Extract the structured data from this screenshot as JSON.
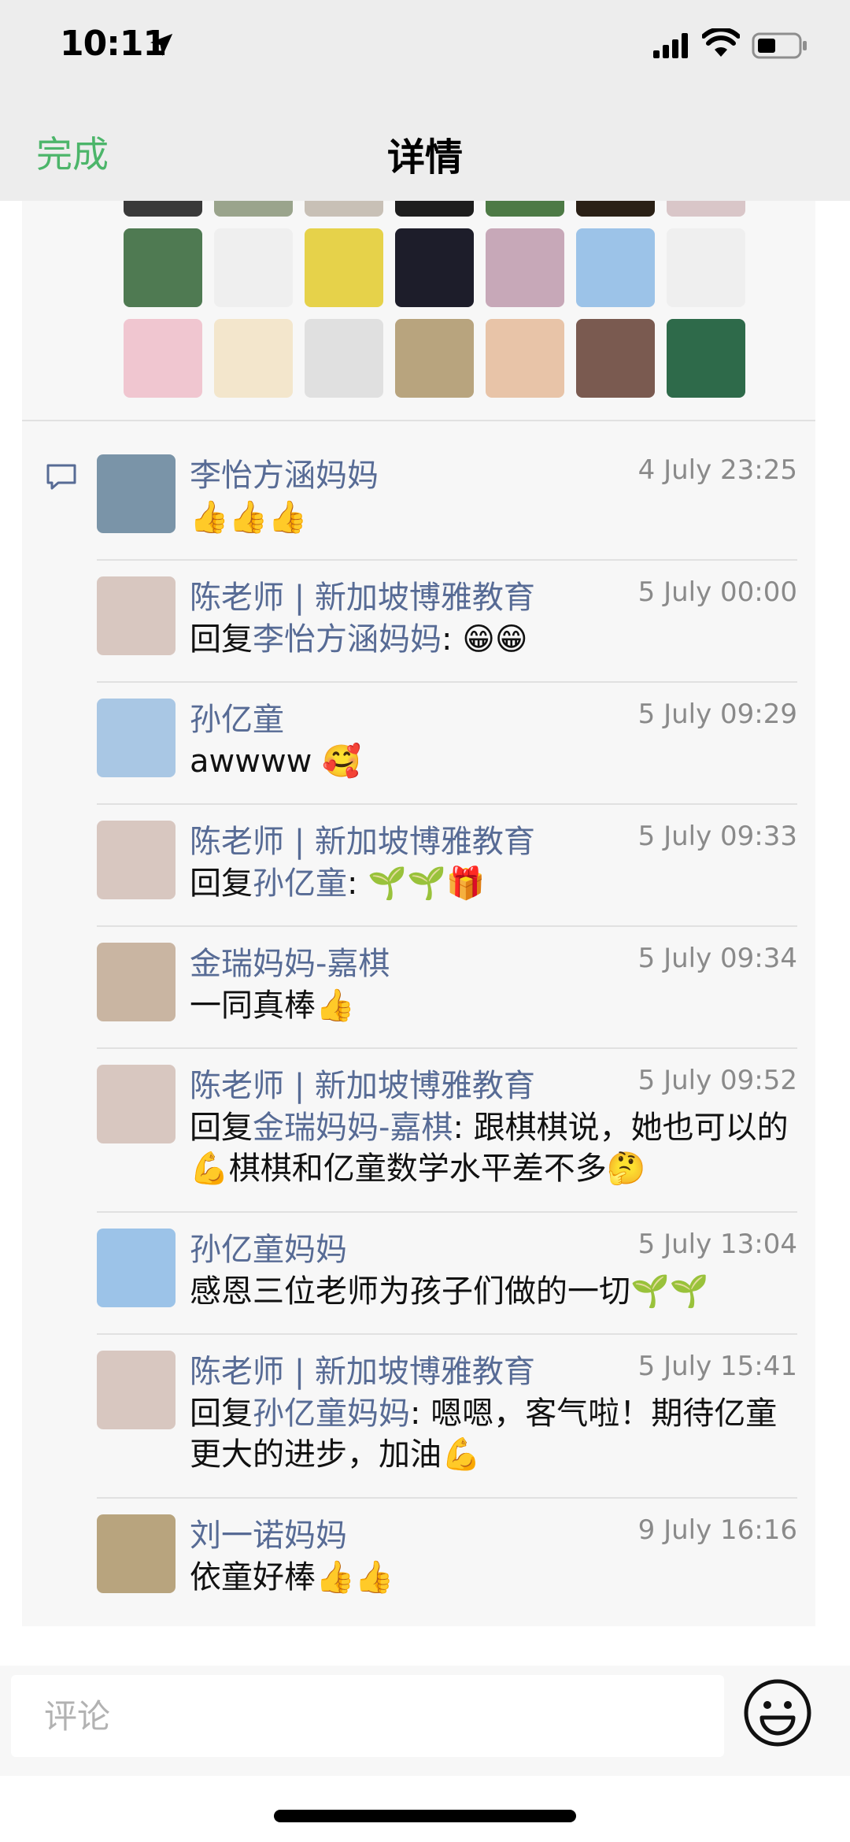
{
  "status_bar": {
    "time": "10:11"
  },
  "nav": {
    "back_label": "完成",
    "title": "详情"
  },
  "likes": {
    "avatar_colors": [
      "#3a3a3a",
      "#9aa48c",
      "#c8c0b6",
      "#1e1e1e",
      "#4d7a45",
      "#2a2016",
      "#d9c6c8",
      "#4f7a52",
      "#efefef",
      "#e6d24a",
      "#1d1d2a",
      "#c7a8b8",
      "#9cc3e8",
      "#efefef",
      "#f0c6d0",
      "#f3e6cc",
      "#e0e0e0",
      "#b8a47e",
      "#e8c4a8",
      "#7a5a50",
      "#2e6a4a"
    ]
  },
  "comments": [
    {
      "name": "李怡方涵妈妈",
      "time": "4 July  23:25",
      "text": "👍👍👍",
      "avatar_color": "#7a94a8"
    },
    {
      "name": "陈老师 | 新加坡博雅教育",
      "time": "5 July  00:00",
      "prefix": "回复",
      "reply_to": "李怡方涵妈妈",
      "text": ": 😁😁",
      "avatar_color": "#d8c7c0"
    },
    {
      "name": "孙亿童",
      "time": "5 July  09:29",
      "text": "awwww 🥰",
      "avatar_color": "#a9c7e4"
    },
    {
      "name": "陈老师 | 新加坡博雅教育",
      "time": "5 July  09:33",
      "prefix": "回复",
      "reply_to": "孙亿童",
      "text": ": 🌱🌱🎁",
      "avatar_color": "#d8c7c0"
    },
    {
      "name": "金瑞妈妈-嘉棋",
      "time": "5 July  09:34",
      "text": "一同真棒👍",
      "avatar_color": "#c9b5a2"
    },
    {
      "name": "陈老师 | 新加坡博雅教育",
      "time": "5 July  09:52",
      "prefix": "回复",
      "reply_to": "金瑞妈妈-嘉棋",
      "text": ": 跟棋棋说，她也可以的💪棋棋和亿童数学水平差不多🤔",
      "avatar_color": "#d8c7c0"
    },
    {
      "name": "孙亿童妈妈",
      "time": "5 July  13:04",
      "text": "感恩三位老师为孩子们做的一切🌱🌱",
      "avatar_color": "#9cc3e8"
    },
    {
      "name": "陈老师 | 新加坡博雅教育",
      "time": "5 July  15:41",
      "prefix": "回复",
      "reply_to": "孙亿童妈妈",
      "text": ": 嗯嗯，客气啦！期待亿童更大的进步，加油💪",
      "avatar_color": "#d8c7c0"
    },
    {
      "name": "刘一诺妈妈",
      "time": "9 July  16:16",
      "text": "依童好棒👍👍",
      "avatar_color": "#b8a47e"
    }
  ],
  "input": {
    "placeholder": "评论"
  }
}
